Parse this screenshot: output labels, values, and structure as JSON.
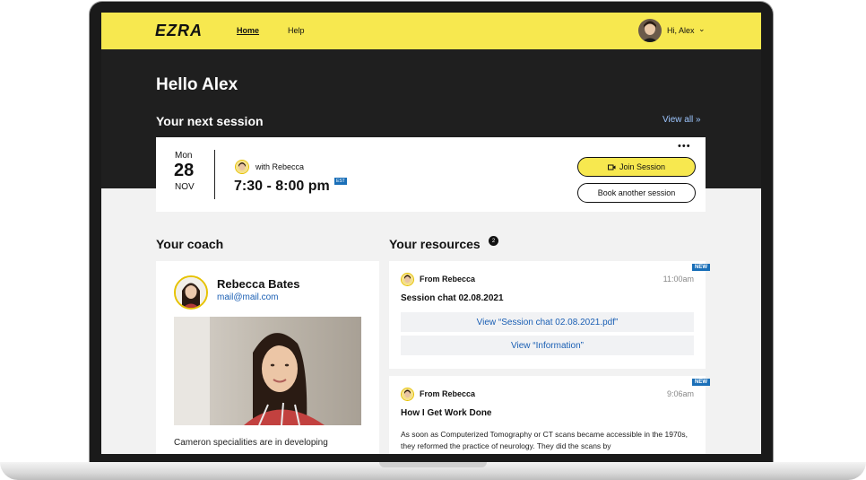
{
  "header": {
    "logo": "EZRA",
    "nav": {
      "home": "Home",
      "help": "Help"
    },
    "user_greeting": "Hi, Alex",
    "colors": {
      "brand_yellow": "#f7e84f",
      "dark": "#1f1f1f",
      "link_blue": "#1a5fb4",
      "badge_blue": "#1a6fb8"
    }
  },
  "hero": {
    "greeting": "Hello Alex",
    "next_session_title": "Your next session",
    "view_all": "View all »"
  },
  "session": {
    "day_name": "Mon",
    "day_number": "28",
    "month": "NOV",
    "with_label": "with Rebecca",
    "time": "7:30 - 8:00 pm",
    "timezone": "EST",
    "more_icon": "more-dots-icon",
    "join_label": "Join Session",
    "book_label": "Book another session"
  },
  "coach": {
    "section_title": "Your coach",
    "name": "Rebecca Bates",
    "email": "mail@mail.com",
    "bio": "Cameron specialities are in developing"
  },
  "resources": {
    "section_title": "Your resources",
    "count": "2",
    "items": [
      {
        "from": "From Rebecca",
        "time": "11:00am",
        "badge": "NEW",
        "title": "Session chat 02.08.2021",
        "links": [
          "View “Session chat 02.08.2021.pdf”",
          "View “Information”"
        ]
      },
      {
        "from": "From Rebecca",
        "time": "9:06am",
        "badge": "NEW",
        "title": "How I Get Work Done",
        "body": "As soon as Computerized Tomography or CT scans became accessible in the 1970s, they reformed the practice of neurology. They did the scans by"
      }
    ]
  }
}
